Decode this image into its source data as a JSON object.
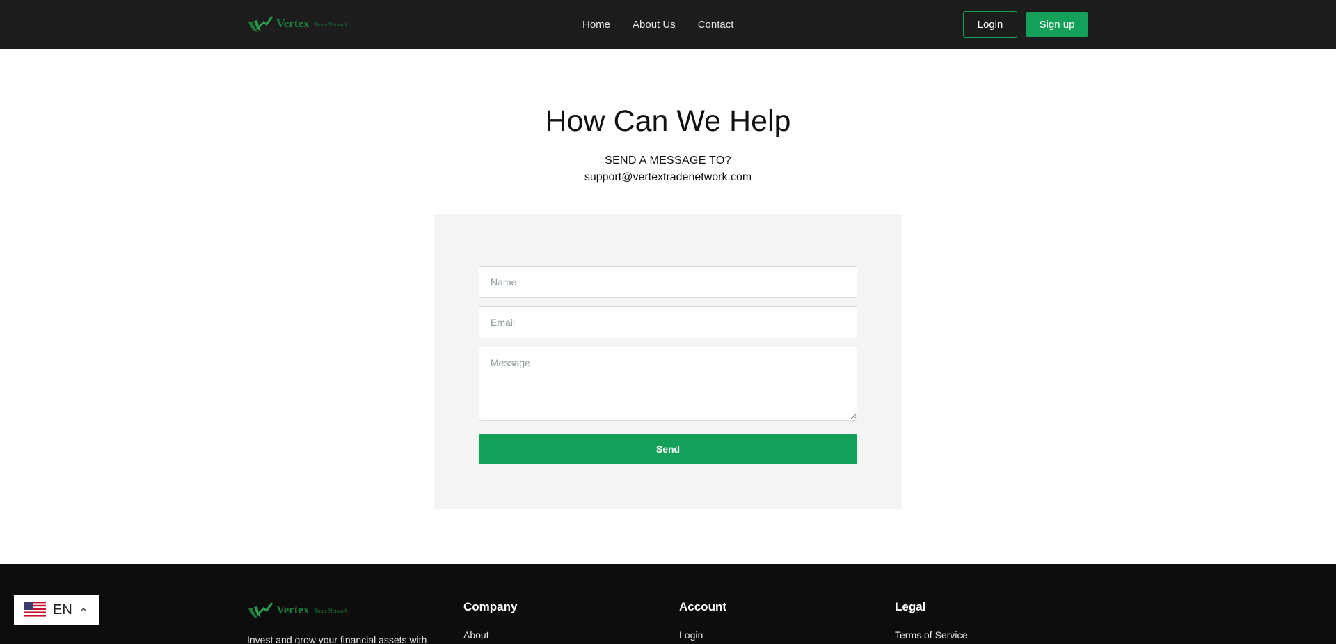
{
  "brand": {
    "name": "Vertex",
    "sub": "Trade Network"
  },
  "colors": {
    "accent": "#15a05a",
    "header_bg": "#1c1c1c",
    "footer_bg": "#0d0d0d",
    "card_bg": "#f4f4f4"
  },
  "nav": {
    "items": [
      "Home",
      "About Us",
      "Contact"
    ]
  },
  "header": {
    "login_label": "Login",
    "signup_label": "Sign up"
  },
  "main": {
    "title": "How Can We Help",
    "subtitle": "SEND A MESSAGE TO?",
    "email": "support@vertextradenetwork.com"
  },
  "form": {
    "name_placeholder": "Name",
    "email_placeholder": "Email",
    "message_placeholder": "Message",
    "send_label": "Send"
  },
  "footer": {
    "tagline": "Invest and grow your financial assets with",
    "columns": [
      {
        "heading": "Company",
        "links": [
          "About"
        ]
      },
      {
        "heading": "Account",
        "links": [
          "Login"
        ]
      },
      {
        "heading": "Legal",
        "links": [
          "Terms of Service"
        ]
      }
    ]
  },
  "language": {
    "code": "EN",
    "flag_icon": "us-flag-icon"
  }
}
